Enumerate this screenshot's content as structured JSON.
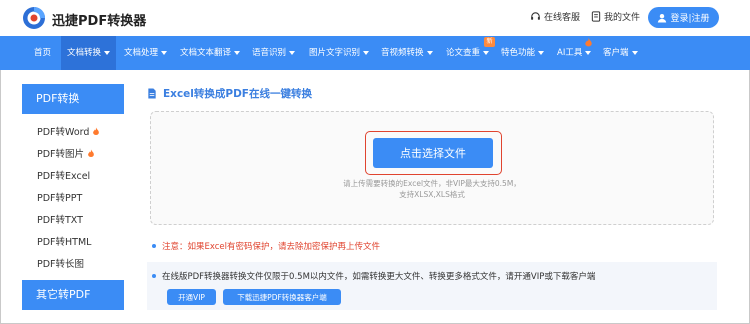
{
  "header": {
    "brand": "迅捷PDF转换器",
    "service_label": "在线客服",
    "files_label": "我的文件",
    "login_label": "登录|注册"
  },
  "nav": {
    "items": [
      {
        "label": "首页",
        "caret": false
      },
      {
        "label": "文档转换",
        "caret": true,
        "active": true
      },
      {
        "label": "文档处理",
        "caret": true
      },
      {
        "label": "文档文本翻译",
        "caret": true
      },
      {
        "label": "语音识别",
        "caret": true
      },
      {
        "label": "图片文字识别",
        "caret": true
      },
      {
        "label": "音视频转换",
        "caret": true
      },
      {
        "label": "论文查重",
        "caret": true
      },
      {
        "label": "特色功能",
        "caret": true
      },
      {
        "label": "AI工具",
        "caret": true
      },
      {
        "label": "客户端",
        "caret": true
      }
    ],
    "new_badge": "新"
  },
  "sidebar": {
    "heading": "PDF转换",
    "items": [
      {
        "label": "PDF转Word",
        "hot": true
      },
      {
        "label": "PDF转图片",
        "hot": true
      },
      {
        "label": "PDF转Excel",
        "hot": false
      },
      {
        "label": "PDF转PPT",
        "hot": false
      },
      {
        "label": "PDF转TXT",
        "hot": false
      },
      {
        "label": "PDF转HTML",
        "hot": false
      },
      {
        "label": "PDF转长图",
        "hot": false
      }
    ],
    "heading2": "其它转PDF"
  },
  "main": {
    "title": "Excel转换成PDF在线一键转换",
    "upload_button": "点击选择文件",
    "hint_line1": "请上传需要转换的Excel文件，非VIP最大支持0.5M，",
    "hint_line2": "支持XLSX,XLS格式",
    "note": "注意：如果Excel有密码保护，请去除加密保护再上传文件",
    "vip_text": "在线版PDF转换器转换文件仅限于0.5M以内文件，如需转换更大文件、转换更多格式文件，请开通VIP或下载客户端",
    "vip_button": "开通VIP",
    "download_button": "下载迅捷PDF转换器客户端"
  },
  "colors": {
    "accent": "#3b8cf5",
    "nav_active": "#2d72d9",
    "warning": "#e0442f",
    "hot": "#ff7a2e"
  }
}
